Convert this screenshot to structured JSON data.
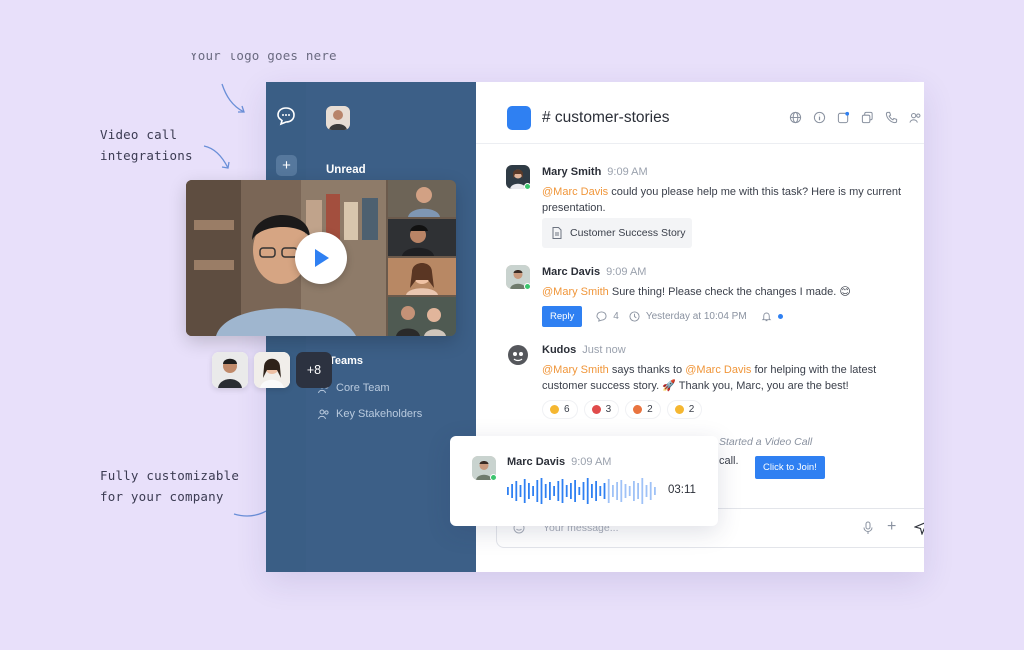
{
  "annotations": {
    "top": "Your logo goes here",
    "video": [
      "Video call",
      "integrations"
    ],
    "custom": [
      "Fully customizable",
      "for your company"
    ]
  },
  "sidebar": {
    "section_unread": "Unread",
    "section_teams": "Teams",
    "teams": [
      "Core Team",
      "Key Stakeholders"
    ]
  },
  "rail": {
    "add_label": "+"
  },
  "header": {
    "channel": "# customer-stories",
    "tools": [
      "globe-icon",
      "info-icon",
      "edit-icon",
      "copy-icon",
      "phone-icon",
      "members-icon"
    ]
  },
  "messages": [
    {
      "name": "Mary Smith",
      "time": "9:09 AM",
      "mention": "@Marc Davis",
      "text": " could you please help me with this task? Here is my current presentation.",
      "attachment": "Customer Success Story"
    },
    {
      "name": "Marc Davis",
      "time": "9:09 AM",
      "mention": "@Mary Smith",
      "text": " Sure thing! Please check the changes I made. 😊",
      "reply_label": "Reply",
      "reply_count": "4",
      "reply_time": "Yesterday at 10:04 PM"
    },
    {
      "name": "Kudos",
      "time": "Just now",
      "mention": "@Mary Smith",
      "text_a": " says thanks to ",
      "mention2": "@Marc Davis",
      "text_b": " for helping with the latest customer success story. 🚀 Thank you, Marc, you are the best!",
      "reactions": [
        {
          "count": "6",
          "color": "#f5b731"
        },
        {
          "count": "3",
          "color": "#e04b4b"
        },
        {
          "count": "2",
          "color": "#e9743f"
        },
        {
          "count": "2",
          "color": "#f5b731"
        }
      ]
    }
  ],
  "video_call": {
    "started": "Started a Video Call",
    "call_text": "call.",
    "join_label": "Click to Join!"
  },
  "composer": {
    "placeholder": "Your message..."
  },
  "participants": {
    "more": "+8"
  },
  "voice_message": {
    "name": "Marc Davis",
    "time": "9:09 AM",
    "duration": "03:11"
  },
  "colors": {
    "accent": "#2f80f2",
    "sidebar": "#3c5f87",
    "mention": "#f0963a",
    "online": "#3cc46d"
  }
}
